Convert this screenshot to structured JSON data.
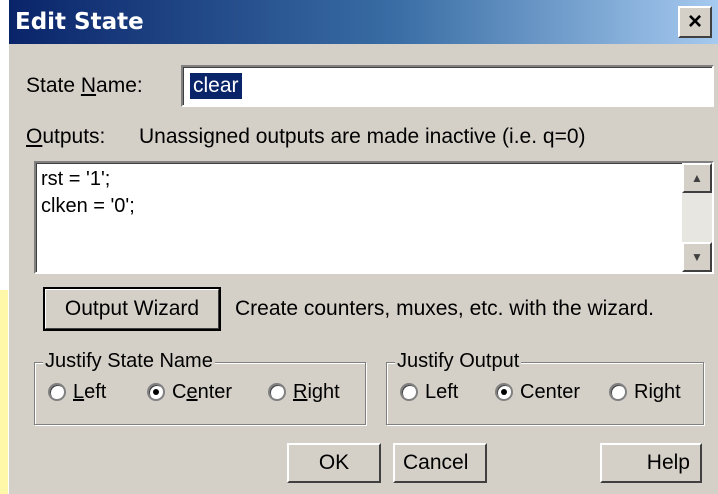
{
  "window": {
    "title": "Edit State",
    "close_glyph": "×"
  },
  "state_name": {
    "label_before": "State ",
    "label_underline": "N",
    "label_after": "ame:",
    "value": "clear"
  },
  "outputs": {
    "label_underline": "O",
    "label_after": "utputs:",
    "note": "Unassigned outputs are made inactive (i.e. q=0)",
    "text": "rst = '1';\nclken = '0';"
  },
  "wizard": {
    "button_label": "Output Wizard",
    "hint": "Create counters, muxes, etc. with the wizard."
  },
  "justify_state": {
    "title": "Justify State Name",
    "options": [
      {
        "pre": "",
        "u": "L",
        "post": "eft",
        "selected": false
      },
      {
        "pre": "C",
        "u": "e",
        "post": "nter",
        "selected": true
      },
      {
        "pre": "",
        "u": "R",
        "post": "ight",
        "selected": false
      }
    ]
  },
  "justify_output": {
    "title": "Justify Output",
    "options": [
      {
        "label": "Left",
        "selected": false
      },
      {
        "label": "Center",
        "selected": true
      },
      {
        "label": "Right",
        "selected": false
      }
    ]
  },
  "buttons": {
    "ok": "OK",
    "cancel": "Cancel",
    "help": "Help"
  },
  "icons": {
    "scroll_up": "triangle-up",
    "scroll_down": "triangle-down"
  },
  "colors": {
    "titlebar_start": "#0a246a",
    "titlebar_end": "#a6caf0",
    "face": "#d4d0c8",
    "selection": "#0a246a"
  }
}
